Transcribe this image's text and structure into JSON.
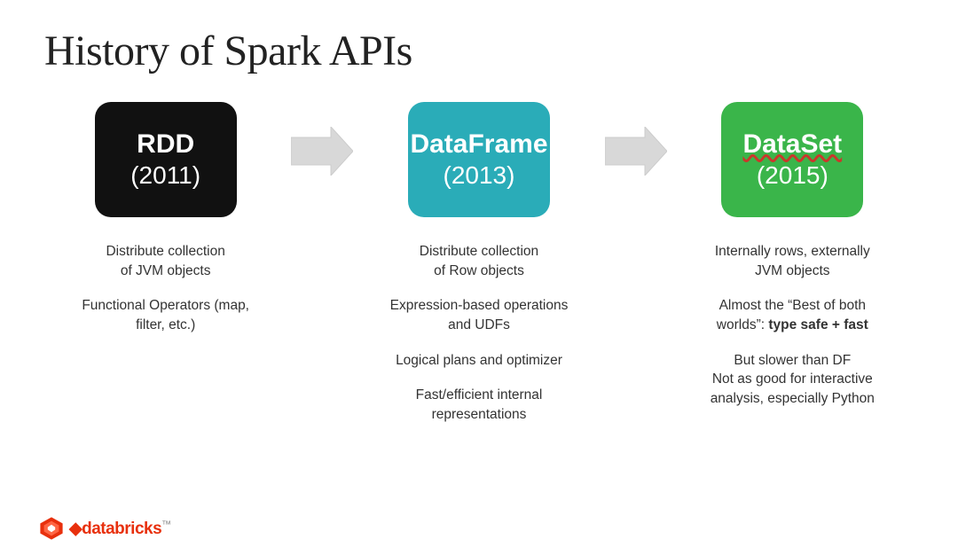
{
  "title": "History of Spark APIs",
  "apis": [
    {
      "id": "rdd",
      "label": "RDD",
      "year": "(2011)",
      "box_class": "rdd",
      "bullets": [
        "Distribute collection\nof JVM objects",
        "Functional Operators (map,\nfilter, etc.)"
      ]
    },
    {
      "id": "dataframe",
      "label": "DataFrame",
      "year": "(2013)",
      "box_class": "dataframe",
      "bullets": [
        "Distribute collection\nof Row objects",
        "Expression-based operations\nand UDFs",
        "Logical plans and optimizer",
        "Fast/efficient internal\nrepresentations"
      ]
    },
    {
      "id": "dataset",
      "label": "DataSet",
      "year": "(2015)",
      "box_class": "dataset",
      "bullets": [
        "Internally rows, externally\nJVM objects",
        "Almost the “Best of both\nworlds”: type safe + fast",
        "But slower than DF\nNot as good for interactive\nanalysis, especially Python"
      ]
    }
  ],
  "logo": {
    "text": "databricks",
    "superscript": "™"
  },
  "colors": {
    "rdd": "#111111",
    "dataframe": "#2aacb8",
    "dataset": "#3ab54a",
    "arrow": "#e0e0e0",
    "text": "#333333",
    "title": "#222222",
    "logo_red": "#e8300d"
  }
}
